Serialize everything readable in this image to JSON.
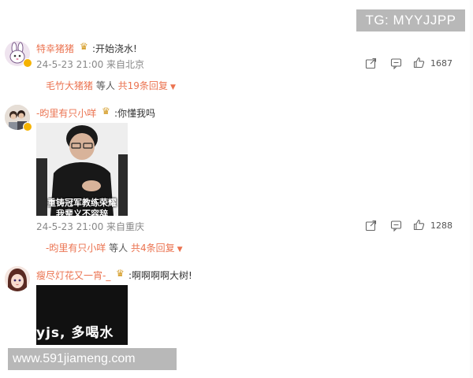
{
  "watermarks": {
    "top": "TG: MYYJJPP",
    "bottom": "www.591jiameng.com"
  },
  "comments": [
    {
      "username": "特幸猪猪",
      "text": ":开始浇水!",
      "meta": "24-5-23 21:00 来自北京",
      "likes": "1687",
      "reply_user": "毛竹大猪猪",
      "reply_mid": " 等人 ",
      "reply_count": "共19条回复"
    },
    {
      "username": "-昀里有只小咩",
      "text": ":你懂我吗",
      "image_caption_1": "重铸冠军教练荣耀",
      "image_caption_2": "我辈义不容辞",
      "meta": "24-5-23 21:00 来自重庆",
      "likes": "1288",
      "reply_user": "-昀里有只小咩",
      "reply_mid": " 等人 ",
      "reply_count": "共4条回复"
    },
    {
      "username": "瘦尽灯花又一宵-_",
      "text": ":啊啊啊啊大树!",
      "image_caption": "yjs, 多喝水"
    }
  ],
  "colors": {
    "username": "#eb7350",
    "meta": "#888888",
    "watermark_bg": "#b8b8b8"
  },
  "icons": [
    "share-icon",
    "comment-icon",
    "like-icon",
    "crown-icon",
    "chevron-down-icon"
  ]
}
